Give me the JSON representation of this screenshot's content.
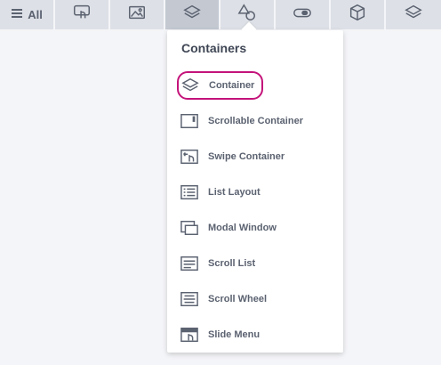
{
  "toolbar": {
    "all_label": "All",
    "tabs": [
      {
        "icon": "hamburger-icon",
        "label": "All"
      },
      {
        "icon": "touch-icon"
      },
      {
        "icon": "image-icon"
      },
      {
        "icon": "layers-icon",
        "active": true
      },
      {
        "icon": "shapes-icon"
      },
      {
        "icon": "toggle-icon"
      },
      {
        "icon": "cube-icon"
      },
      {
        "icon": "stack-icon"
      }
    ]
  },
  "panel": {
    "title": "Containers",
    "items": [
      {
        "label": "Container",
        "icon": "layers-icon",
        "selected": true
      },
      {
        "label": "Scrollable Container",
        "icon": "scrollable-icon"
      },
      {
        "label": "Swipe Container",
        "icon": "swipe-icon"
      },
      {
        "label": "List Layout",
        "icon": "list-icon"
      },
      {
        "label": "Modal Window",
        "icon": "modal-icon"
      },
      {
        "label": "Scroll List",
        "icon": "scroll-list-icon"
      },
      {
        "label": "Scroll Wheel",
        "icon": "scroll-wheel-icon"
      },
      {
        "label": "Slide Menu",
        "icon": "slide-menu-icon"
      }
    ]
  },
  "colors": {
    "accent": "#c4137a",
    "tab_bg": "#dde0e6",
    "tab_active": "#c3c8d1",
    "text": "#5b6270"
  }
}
